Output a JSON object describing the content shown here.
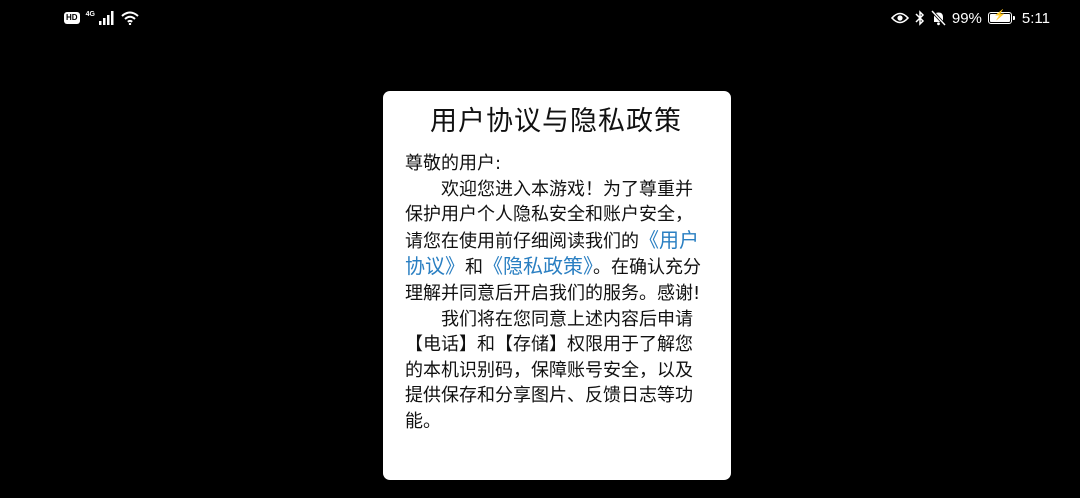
{
  "status_bar": {
    "hd": "HD",
    "network": "4G",
    "battery_percent": "99%",
    "battery_level": 0.99,
    "time": "5:11",
    "icons": [
      "signal-icon",
      "wifi-icon",
      "eye-icon",
      "bluetooth-icon",
      "mute-bell-icon",
      "battery-icon"
    ]
  },
  "dialog": {
    "title": "用户协议与隐私政策",
    "greeting": "尊敬的用户:",
    "p1_before": "欢迎您进入本游戏！为了尊重并保护用户个人隐私安全和账户安全，请您在使用前仔细阅读我们的",
    "link_user_agreement": "《用户协议》",
    "and": "和",
    "link_privacy_policy": "《隐私政策》",
    "p1_after": "。在确认充分理解并同意后开启我们的服务。感谢!",
    "p2": "我们将在您同意上述内容后申请【电话】和【存储】权限用于了解您的本机识别码，保障账号安全，以及提供保存和分享图片、反馈日志等功能。"
  },
  "colors": {
    "background": "#000000",
    "dialog_bg": "#ffffff",
    "link": "#2a7fc2",
    "text": "#111111"
  }
}
